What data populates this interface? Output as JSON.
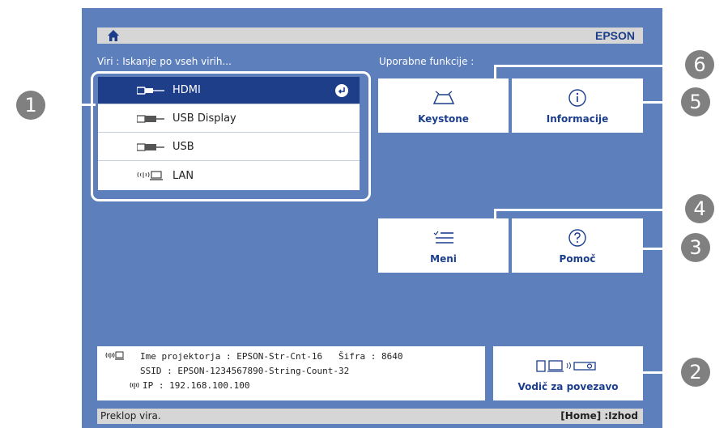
{
  "topbar": {
    "brand": "EPSON",
    "home_icon": "home-icon"
  },
  "sources": {
    "heading": "Viri : Iskanje po vseh virih...",
    "items": [
      {
        "label": "HDMI",
        "icon": "hdmi-icon",
        "selected": true
      },
      {
        "label": "USB Display",
        "icon": "usb-display-icon",
        "selected": false
      },
      {
        "label": "USB",
        "icon": "usb-icon",
        "selected": false
      },
      {
        "label": "LAN",
        "icon": "lan-icon",
        "selected": false
      }
    ]
  },
  "functions": {
    "heading": "Uporabne funkcije :",
    "keystone": "Keystone",
    "information": "Informacije",
    "menu": "Meni",
    "help": "Pomoč",
    "connection_guide": "Vodič za povezavo"
  },
  "info": {
    "line1": "Ime projektorja : EPSON-Str-Cnt-16   Šifra : 8640",
    "line2": "SSID : EPSON-1234567890-String-Count-32",
    "line3": "IP : 192.168.100.100"
  },
  "status": {
    "left": "Preklop vira.",
    "right": "[Home] :Izhod"
  },
  "callouts": [
    "1",
    "2",
    "3",
    "4",
    "5",
    "6"
  ],
  "colors": {
    "background": "#5d7fbc",
    "selected": "#1e3e8a",
    "accent": "#1b3e8c",
    "callout": "#808080"
  }
}
